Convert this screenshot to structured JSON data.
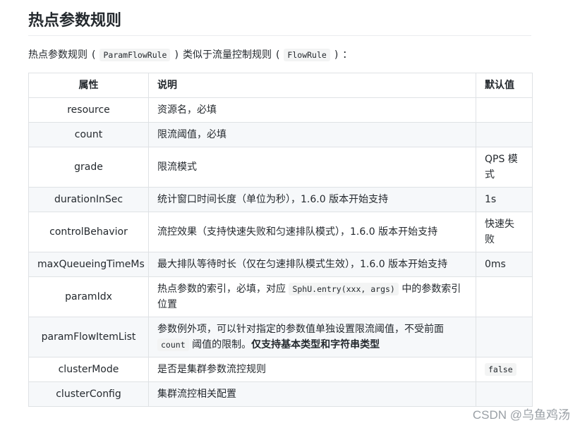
{
  "title": "热点参数规则",
  "intro": {
    "prefix": "热点参数规则",
    "code1": "ParamFlowRule",
    "middle": "类似于流量控制规则",
    "code2": "FlowRule",
    "suffix": "："
  },
  "table": {
    "headers": [
      "属性",
      "说明",
      "默认值"
    ],
    "rows": [
      {
        "name": "resource",
        "desc": "资源名，必填",
        "default": ""
      },
      {
        "name": "count",
        "desc": "限流阈值，必填",
        "default": ""
      },
      {
        "name": "grade",
        "desc": "限流模式",
        "default": "QPS 模式"
      },
      {
        "name": "durationInSec",
        "desc": "统计窗口时间长度（单位为秒），1.6.0 版本开始支持",
        "default": "1s"
      },
      {
        "name": "controlBehavior",
        "desc": "流控效果（支持快速失败和匀速排队模式），1.6.0 版本开始支持",
        "default": "快速失败"
      },
      {
        "name": "maxQueueingTimeMs",
        "desc": "最大排队等待时长（仅在匀速排队模式生效），1.6.0 版本开始支持",
        "default": "0ms"
      },
      {
        "name": "paramIdx",
        "desc_before": "热点参数的索引，必填，对应",
        "desc_code": "SphU.entry(xxx, args)",
        "desc_after": "中的参数索引位置",
        "default": ""
      },
      {
        "name": "paramFlowItemList",
        "desc_before": "参数例外项，可以针对指定的参数值单独设置限流阈值，不受前面",
        "desc_code": "count",
        "desc_after": "阈值的限制。",
        "desc_bold": "仅支持基本类型和字符串类型",
        "default": ""
      },
      {
        "name": "clusterMode",
        "desc": "是否是集群参数流控规则",
        "default_code": "false"
      },
      {
        "name": "clusterConfig",
        "desc": "集群流控相关配置",
        "default": ""
      }
    ]
  },
  "watermark": "CSDN @乌鱼鸡汤"
}
